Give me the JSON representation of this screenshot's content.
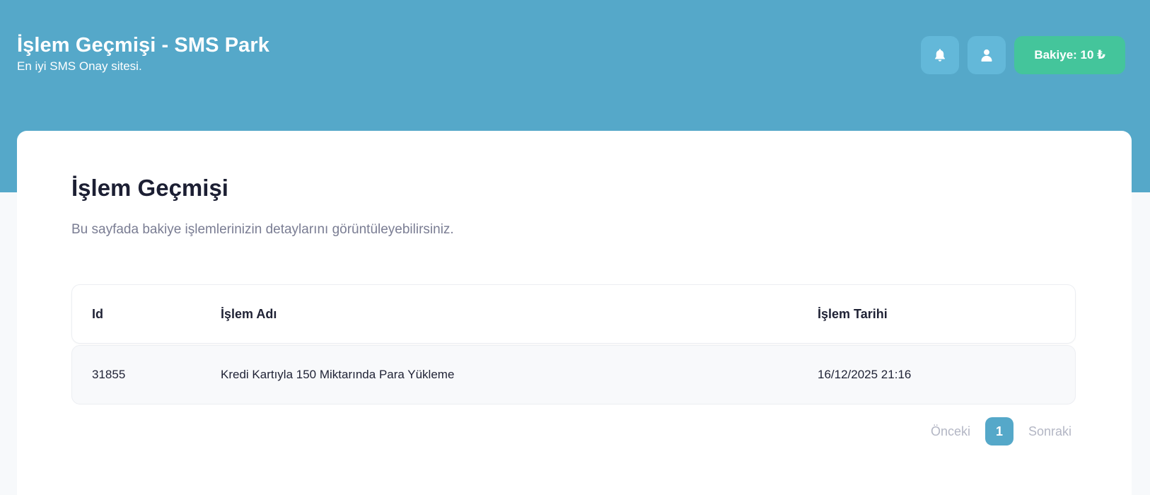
{
  "header": {
    "title": "İşlem Geçmişi - SMS Park",
    "subtitle": "En iyi SMS Onay sitesi.",
    "balance_label": "Bakiye: 10 ₺",
    "notification_icon": "bell-icon",
    "profile_icon": "user-icon"
  },
  "colors": {
    "header_bg": "#55a8c9",
    "icon_button_bg": "#63b8d9",
    "balance_button_bg": "#44c59b",
    "page_bg": "#f7f9fb",
    "card_bg": "#ffffff",
    "active_page_bg": "#55a8c9"
  },
  "main": {
    "title": "İşlem Geçmişi",
    "description": "Bu sayfada bakiye işlemlerinizin detaylarını görüntüleyebilirsiniz."
  },
  "table": {
    "columns": [
      "Id",
      "İşlem Adı",
      "İşlem Tarihi"
    ],
    "rows": [
      [
        "31855",
        "Kredi Kartıyla 150 Miktarında Para Yükleme",
        "16/12/2025 21:16"
      ]
    ]
  },
  "pagination": {
    "prev_label": "Önceki",
    "current_page": "1",
    "next_label": "Sonraki"
  }
}
